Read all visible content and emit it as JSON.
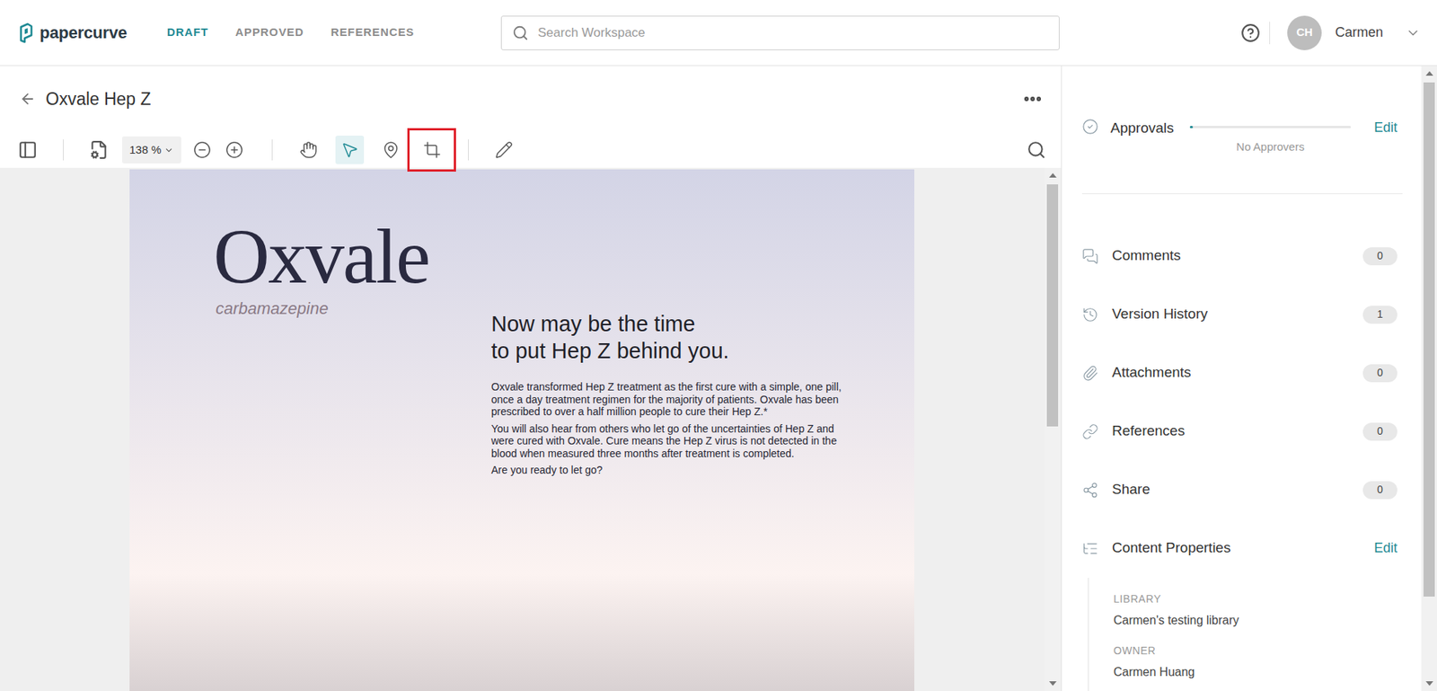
{
  "header": {
    "logo": "papercurve",
    "nav": [
      {
        "label": "DRAFT",
        "selected": true
      },
      {
        "label": "APPROVED",
        "selected": false
      },
      {
        "label": "REFERENCES",
        "selected": false
      }
    ],
    "search": {
      "placeholder": "Search Workspace"
    },
    "user": {
      "initials": "CH",
      "name": "Carmen"
    }
  },
  "document": {
    "title": "Oxvale Hep Z",
    "zoom": "138 %",
    "tools": [
      {
        "kind": "pan",
        "selected": false,
        "outlined": false
      },
      {
        "kind": "select",
        "selected": true,
        "outlined": false
      },
      {
        "kind": "pin",
        "selected": false,
        "outlined": false
      },
      {
        "kind": "region",
        "selected": false,
        "outlined": true
      }
    ],
    "page": {
      "brand": "Oxvale",
      "generic": "carbamazepine",
      "headline": [
        "Now may be the time",
        "to put Hep Z behind you."
      ],
      "paragraphs": [
        "Oxvale transformed Hep Z treatment as the first cure with a simple, one pill, once a day treatment regimen for the majority of patients. Oxvale has been prescribed to over a half million people to cure their Hep Z.*",
        "You will also hear from others who let go of the uncertainties of Hep Z and were cured with Oxvale. Cure means the Hep Z virus is not detected in the blood when measured three months after treatment is completed.",
        "Are you ready to let go?"
      ]
    }
  },
  "sidebar": {
    "approvals": {
      "label": "Approvals",
      "action": "Edit",
      "status": "No Approvers",
      "level": 0.02
    },
    "panels": [
      {
        "kind": "comments",
        "label": "Comments",
        "count": "0"
      },
      {
        "kind": "history",
        "label": "Version History",
        "count": "1"
      },
      {
        "kind": "attachments",
        "label": "Attachments",
        "count": "0"
      },
      {
        "kind": "references",
        "label": "References",
        "count": "0"
      },
      {
        "kind": "share",
        "label": "Share",
        "count": "0"
      }
    ],
    "content_properties": {
      "label": "Content Properties",
      "action": "Edit",
      "fields": [
        {
          "label": "LIBRARY",
          "value": "Carmen's testing library"
        },
        {
          "label": "OWNER",
          "value": "Carmen Huang"
        }
      ]
    }
  }
}
